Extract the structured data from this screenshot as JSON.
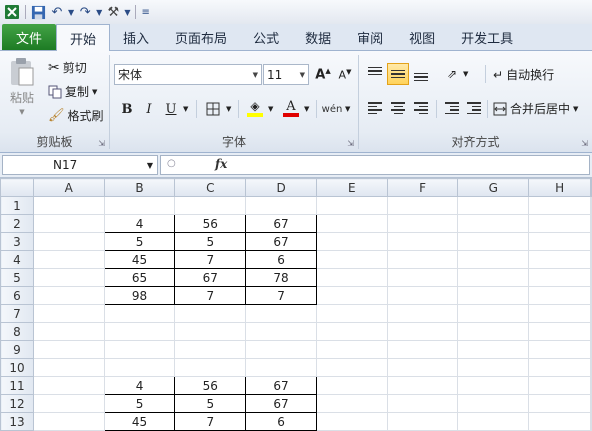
{
  "qat": {
    "save_icon": "save-icon",
    "undo_icon": "undo-icon",
    "redo_icon": "redo-icon",
    "tools_icon": "tools-icon"
  },
  "tabs": [
    {
      "label": "文件",
      "name": "tab-file"
    },
    {
      "label": "开始",
      "name": "tab-home"
    },
    {
      "label": "插入",
      "name": "tab-insert"
    },
    {
      "label": "页面布局",
      "name": "tab-page-layout"
    },
    {
      "label": "公式",
      "name": "tab-formulas"
    },
    {
      "label": "数据",
      "name": "tab-data"
    },
    {
      "label": "审阅",
      "name": "tab-review"
    },
    {
      "label": "视图",
      "name": "tab-view"
    },
    {
      "label": "开发工具",
      "name": "tab-developer"
    }
  ],
  "ribbon": {
    "clipboard": {
      "paste": "粘贴",
      "cut": "剪切",
      "copy": "复制",
      "format_painter": "格式刷",
      "label": "剪贴板"
    },
    "font": {
      "name": "宋体",
      "size": "11",
      "bold": "B",
      "italic": "I",
      "underline": "U",
      "label": "字体"
    },
    "alignment": {
      "wrap_text": "自动换行",
      "merge_center": "合并后居中",
      "label": "对齐方式"
    }
  },
  "formula_bar": {
    "cell_ref": "N17",
    "fx": "fx"
  },
  "sheet": {
    "columns": [
      "A",
      "B",
      "C",
      "D",
      "E",
      "F",
      "G",
      "H"
    ],
    "rows": [
      {
        "num": "1",
        "cells": [
          "",
          "",
          "",
          ""
        ]
      },
      {
        "num": "2",
        "cells": [
          "",
          "4",
          "56",
          "67"
        ]
      },
      {
        "num": "3",
        "cells": [
          "",
          "5",
          "5",
          "67"
        ]
      },
      {
        "num": "4",
        "cells": [
          "",
          "45",
          "7",
          "6"
        ]
      },
      {
        "num": "5",
        "cells": [
          "",
          "65",
          "67",
          "78"
        ]
      },
      {
        "num": "6",
        "cells": [
          "",
          "98",
          "7",
          "7"
        ]
      },
      {
        "num": "7",
        "cells": [
          "",
          "",
          "",
          ""
        ]
      },
      {
        "num": "8",
        "cells": [
          "",
          "",
          "",
          ""
        ]
      },
      {
        "num": "9",
        "cells": [
          "",
          "",
          "",
          ""
        ]
      },
      {
        "num": "10",
        "cells": [
          "",
          "",
          "",
          ""
        ]
      },
      {
        "num": "11",
        "cells": [
          "",
          "4",
          "56",
          "67"
        ]
      },
      {
        "num": "12",
        "cells": [
          "",
          "5",
          "5",
          "67"
        ]
      },
      {
        "num": "13",
        "cells": [
          "",
          "45",
          "7",
          "6"
        ]
      }
    ],
    "bordered_rows": [
      "2",
      "3",
      "4",
      "5",
      "6",
      "11",
      "12",
      "13"
    ]
  }
}
